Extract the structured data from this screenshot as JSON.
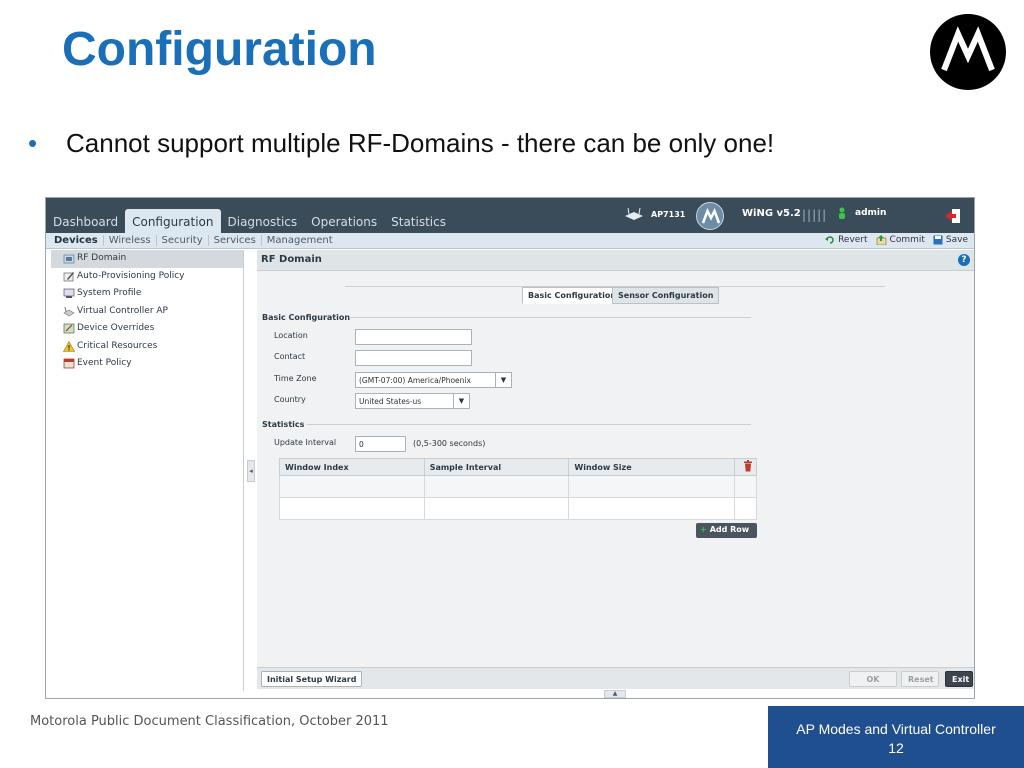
{
  "slide": {
    "title": "Configuration",
    "bullet": "Cannot support multiple RF-Domains - there can be only one!",
    "footer_left": "Motorola Public Document Classification, October 2011",
    "footer_box_line1": "AP Modes and Virtual Controller",
    "footer_box_line2": "12",
    "brand_color": "#1a6fb8"
  },
  "app": {
    "top_tabs": [
      "Dashboard",
      "Configuration",
      "Diagnostics",
      "Operations",
      "Statistics"
    ],
    "active_tab": "Configuration",
    "device_label": "AP7131",
    "version": "WiNG v5.2",
    "signal": "|||||",
    "user": "admin",
    "sub_tabs": [
      "Devices",
      "Wireless",
      "Security",
      "Services",
      "Management"
    ],
    "actions": {
      "revert": "Revert",
      "commit": "Commit",
      "save": "Save"
    },
    "sidebar": [
      {
        "label": "RF Domain",
        "icon": "rf-domain-icon",
        "active": true
      },
      {
        "label": "Auto-Provisioning Policy",
        "icon": "provisioning-icon"
      },
      {
        "label": "System Profile",
        "icon": "system-profile-icon"
      },
      {
        "label": "Virtual Controller AP",
        "icon": "virtual-controller-icon"
      },
      {
        "label": "Device Overrides",
        "icon": "device-overrides-icon"
      },
      {
        "label": "Critical Resources",
        "icon": "warning-icon"
      },
      {
        "label": "Event Policy",
        "icon": "event-policy-icon"
      }
    ],
    "content": {
      "title": "RF Domain",
      "tabs": [
        "Basic Configuration",
        "Sensor Configuration"
      ],
      "active_tab": "Basic Configuration",
      "basic_section": "Basic Configuration",
      "fields": {
        "location_label": "Location",
        "location_value": "",
        "contact_label": "Contact",
        "contact_value": "",
        "timezone_label": "Time Zone",
        "timezone_value": "(GMT-07:00) America/Phoenix",
        "country_label": "Country",
        "country_value": "United States-us"
      },
      "stats_section": "Statistics",
      "update_interval_label": "Update Interval",
      "update_interval_value": "0",
      "update_interval_hint": "(0,5-300 seconds)",
      "table_headers": [
        "Window Index",
        "Sample Interval",
        "Window Size"
      ],
      "add_row": "Add Row"
    },
    "bottom": {
      "wizard": "Initial Setup Wizard",
      "ok": "OK",
      "reset": "Reset",
      "exit": "Exit"
    }
  }
}
